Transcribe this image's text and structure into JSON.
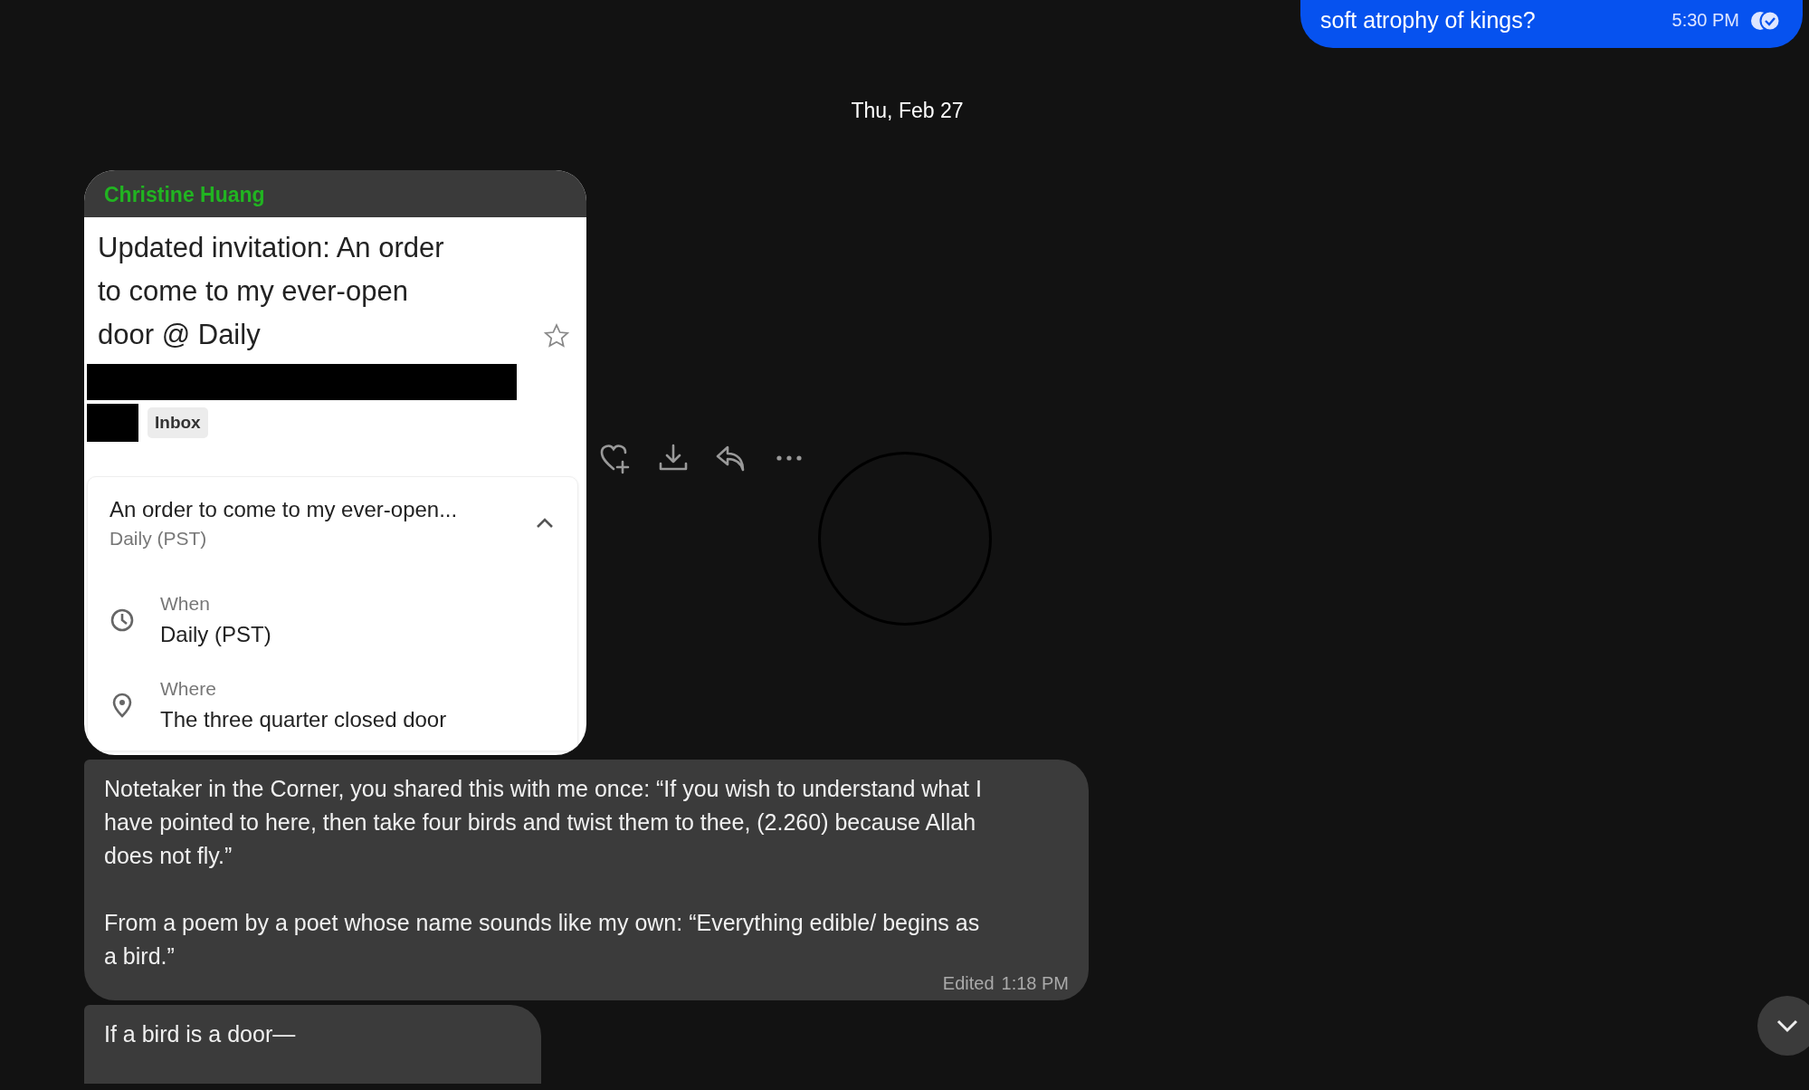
{
  "outgoing": {
    "text": "soft atrophy of kings?",
    "time": "5:30 PM",
    "read": true
  },
  "date_divider": "Thu, Feb 27",
  "email_message": {
    "sender": "Christine Huang",
    "subject": "Updated invitation: An order to come to my ever-open door @ Daily",
    "starred": false,
    "label": "Inbox",
    "event": {
      "title": "An order to come to my ever-open...",
      "subtitle": "Daily (PST)",
      "expanded": true,
      "details": [
        {
          "kind": "when",
          "label": "When",
          "value": "Daily (PST)"
        },
        {
          "kind": "where",
          "label": "Where",
          "value": "The three quarter closed door"
        }
      ]
    }
  },
  "messages": [
    {
      "paragraphs": [
        "Notetaker in the Corner, you shared this with me once: “If you wish to understand what I have pointed to here, then take four birds and twist them to thee, (2.260) because Allah does not fly.”",
        "From a poem by a poet whose name sounds like my own: “Everything edible/ begins as a bird.”"
      ],
      "edited": "Edited",
      "time": "1:18 PM"
    },
    {
      "paragraphs": [
        "If a bird is a door—"
      ]
    }
  ]
}
